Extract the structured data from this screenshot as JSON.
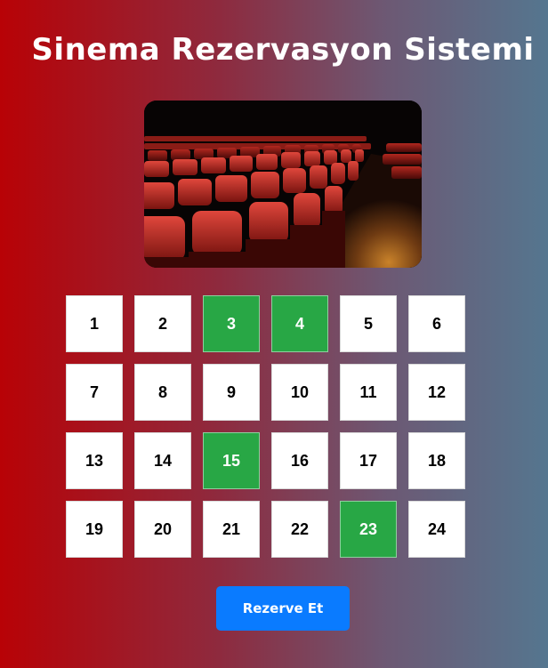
{
  "page": {
    "title": "Sinema Rezervasyon Sistemi"
  },
  "hero": {
    "image": "cinema-seats-photo"
  },
  "seats": [
    {
      "label": "1",
      "reserved": false
    },
    {
      "label": "2",
      "reserved": false
    },
    {
      "label": "3",
      "reserved": true
    },
    {
      "label": "4",
      "reserved": true
    },
    {
      "label": "5",
      "reserved": false
    },
    {
      "label": "6",
      "reserved": false
    },
    {
      "label": "7",
      "reserved": false
    },
    {
      "label": "8",
      "reserved": false
    },
    {
      "label": "9",
      "reserved": false
    },
    {
      "label": "10",
      "reserved": false
    },
    {
      "label": "11",
      "reserved": false
    },
    {
      "label": "12",
      "reserved": false
    },
    {
      "label": "13",
      "reserved": false
    },
    {
      "label": "14",
      "reserved": false
    },
    {
      "label": "15",
      "reserved": true
    },
    {
      "label": "16",
      "reserved": false
    },
    {
      "label": "17",
      "reserved": false
    },
    {
      "label": "18",
      "reserved": false
    },
    {
      "label": "19",
      "reserved": false
    },
    {
      "label": "20",
      "reserved": false
    },
    {
      "label": "21",
      "reserved": false
    },
    {
      "label": "22",
      "reserved": false
    },
    {
      "label": "23",
      "reserved": true
    },
    {
      "label": "24",
      "reserved": false
    }
  ],
  "reserve_button": {
    "label": "Rezerve Et"
  },
  "colors": {
    "reserved": "#28a745",
    "available": "#ffffff",
    "button": "#0a7bff",
    "gradient_left": "#b80206",
    "gradient_right": "#55768f"
  }
}
